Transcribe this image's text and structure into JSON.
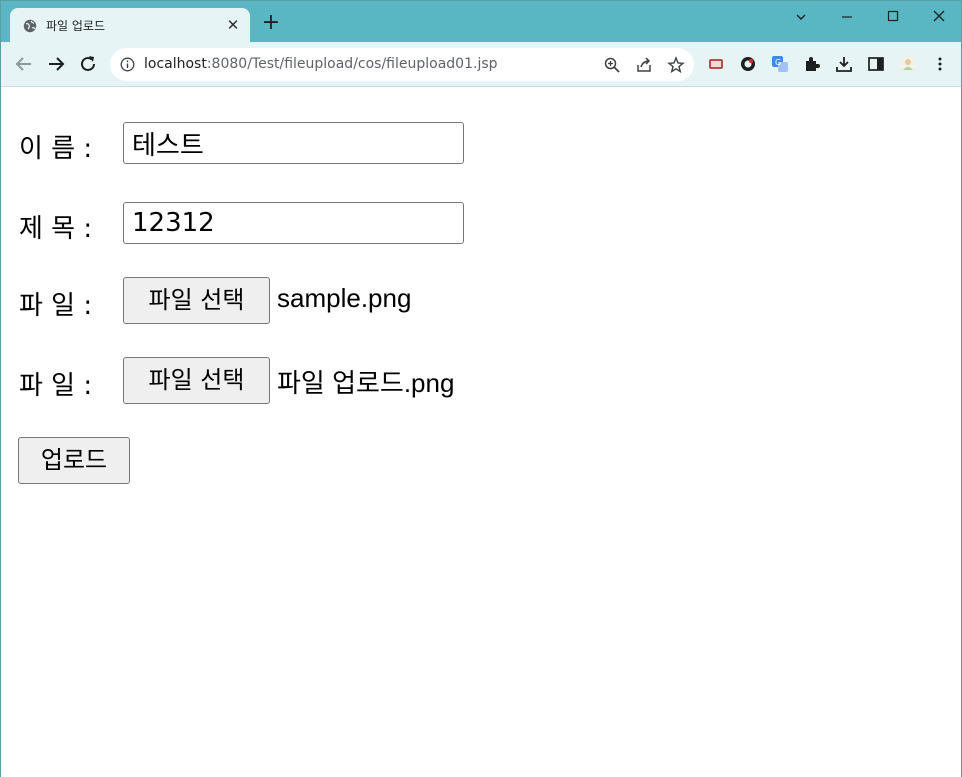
{
  "browser": {
    "tab": {
      "title": "파일 업로드",
      "close_glyph": "✕"
    },
    "new_tab_glyph": "+",
    "window_controls": {
      "dropdown": "⌄",
      "minimize": "—",
      "maximize": "☐",
      "close": "✕"
    },
    "address": {
      "host": "localhost",
      "path": ":8080/Test/fileupload/cos/fileupload01.jsp"
    },
    "colors": {
      "frame": "#58b7c3",
      "toolbar": "#e6f4f6"
    }
  },
  "form": {
    "name": {
      "label": "이 름 :",
      "value": "테스트"
    },
    "subject": {
      "label": "제 목 :",
      "value": "12312"
    },
    "file1": {
      "label": "파 일 :",
      "button_label": "파일 선택",
      "file_name": "sample.png"
    },
    "file2": {
      "label": "파 일 :",
      "button_label": "파일 선택",
      "file_name": "파일 업로드.png"
    },
    "submit_label": "업로드"
  }
}
